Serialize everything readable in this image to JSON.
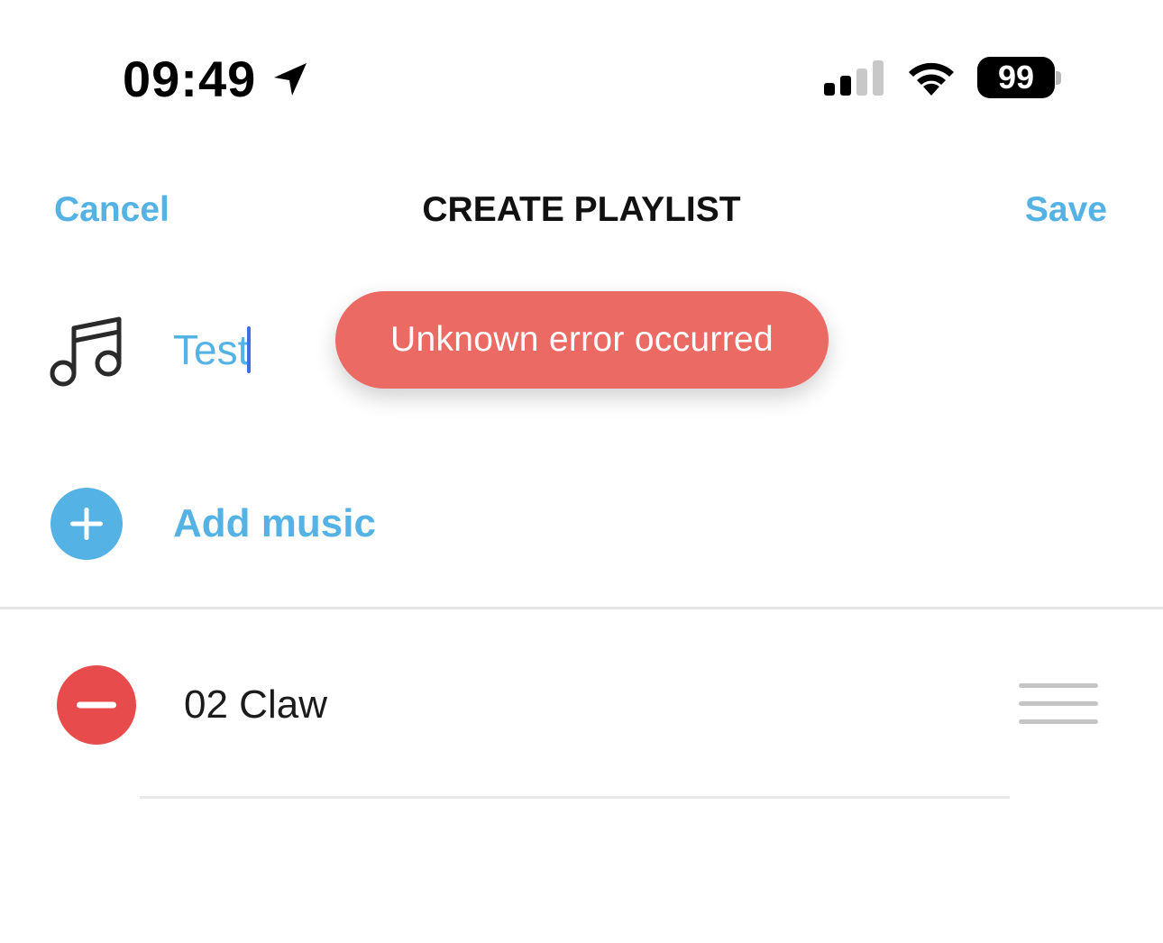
{
  "status_bar": {
    "time": "09:49",
    "battery": "99",
    "icons": [
      "location-arrow-icon",
      "cellular-signal-icon",
      "wifi-icon",
      "battery-icon"
    ]
  },
  "nav": {
    "cancel_label": "Cancel",
    "title": "CREATE PLAYLIST",
    "save_label": "Save"
  },
  "playlist": {
    "name_value": "Test",
    "icon": "music-note-icon"
  },
  "toast": {
    "message": "Unknown error occurred",
    "color": "#ec6a64"
  },
  "add_music": {
    "label": "Add music",
    "icon": "plus-circle-icon"
  },
  "tracks": [
    {
      "title": "02 Claw",
      "remove_icon": "minus-circle-icon",
      "handle_icon": "drag-handle-icon"
    }
  ],
  "colors": {
    "accent": "#54b3e4",
    "remove": "#e84b4b",
    "caret": "#3e6fe0"
  }
}
